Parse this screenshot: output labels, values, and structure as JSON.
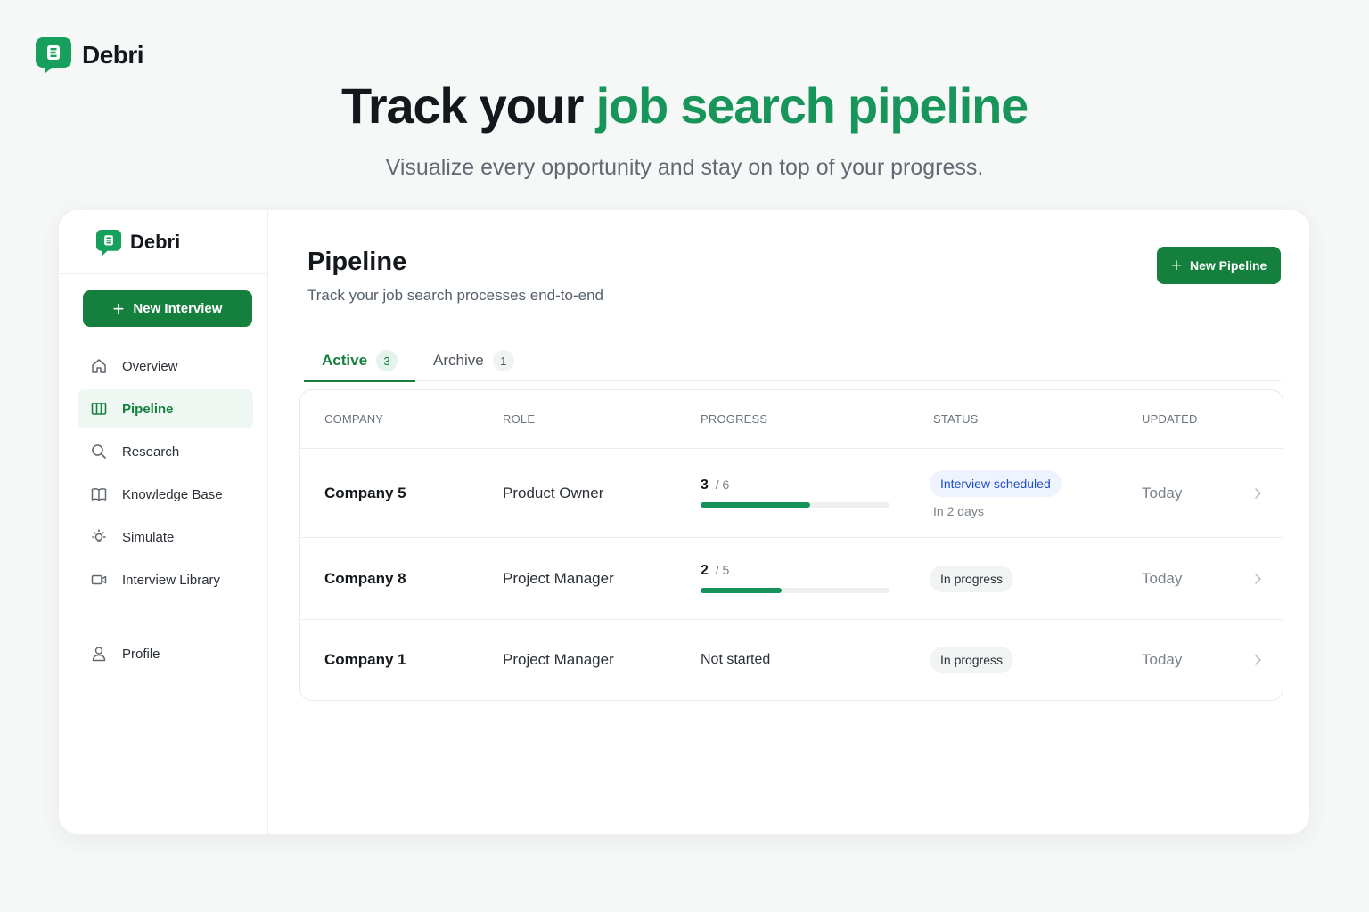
{
  "brand": {
    "name": "Debri",
    "color": "#15803d"
  },
  "hero": {
    "title_main": "Track your",
    "title_accent": "job search pipeline",
    "subtitle": "Visualize every opportunity and stay on top of your progress."
  },
  "sidebar": {
    "new_interview": "New Interview",
    "items": [
      {
        "label": "Overview",
        "icon": "home-icon"
      },
      {
        "label": "Pipeline",
        "icon": "columns-icon",
        "active": true
      },
      {
        "label": "Research",
        "icon": "search-icon"
      },
      {
        "label": "Knowledge Base",
        "icon": "book-icon"
      },
      {
        "label": "Simulate",
        "icon": "lightbulb-icon"
      },
      {
        "label": "Interview Library",
        "icon": "video-icon"
      }
    ],
    "profile": {
      "label": "Profile",
      "icon": "user-icon"
    }
  },
  "main": {
    "title": "Pipeline",
    "subtitle": "Track your job search processes end-to-end",
    "new_pipeline": "New Pipeline",
    "tabs": [
      {
        "label": "Active",
        "count": "3",
        "active": true
      },
      {
        "label": "Archive",
        "count": "1"
      }
    ]
  },
  "table": {
    "headers": {
      "company": "Company",
      "role": "Role",
      "progress": "Progress",
      "status": "Status",
      "updated": "Updated"
    },
    "rows": [
      {
        "company": "Company 5",
        "role": "Product Owner",
        "progress_done": "3",
        "progress_total": "/ 6",
        "progress_fraction": 0.58,
        "status": "Interview scheduled",
        "status_sub": "In 2 days",
        "status_color": "#1e4fc6",
        "updated": "Today"
      },
      {
        "company": "Company 8",
        "role": "Project Manager",
        "progress_done": "2",
        "progress_total": "/ 5",
        "progress_fraction": 0.43,
        "status": "In progress",
        "updated": "Today"
      },
      {
        "company": "Company 1",
        "role": "Project Manager",
        "progress_text": "Not started",
        "status": "In progress",
        "updated": "Today"
      }
    ]
  }
}
